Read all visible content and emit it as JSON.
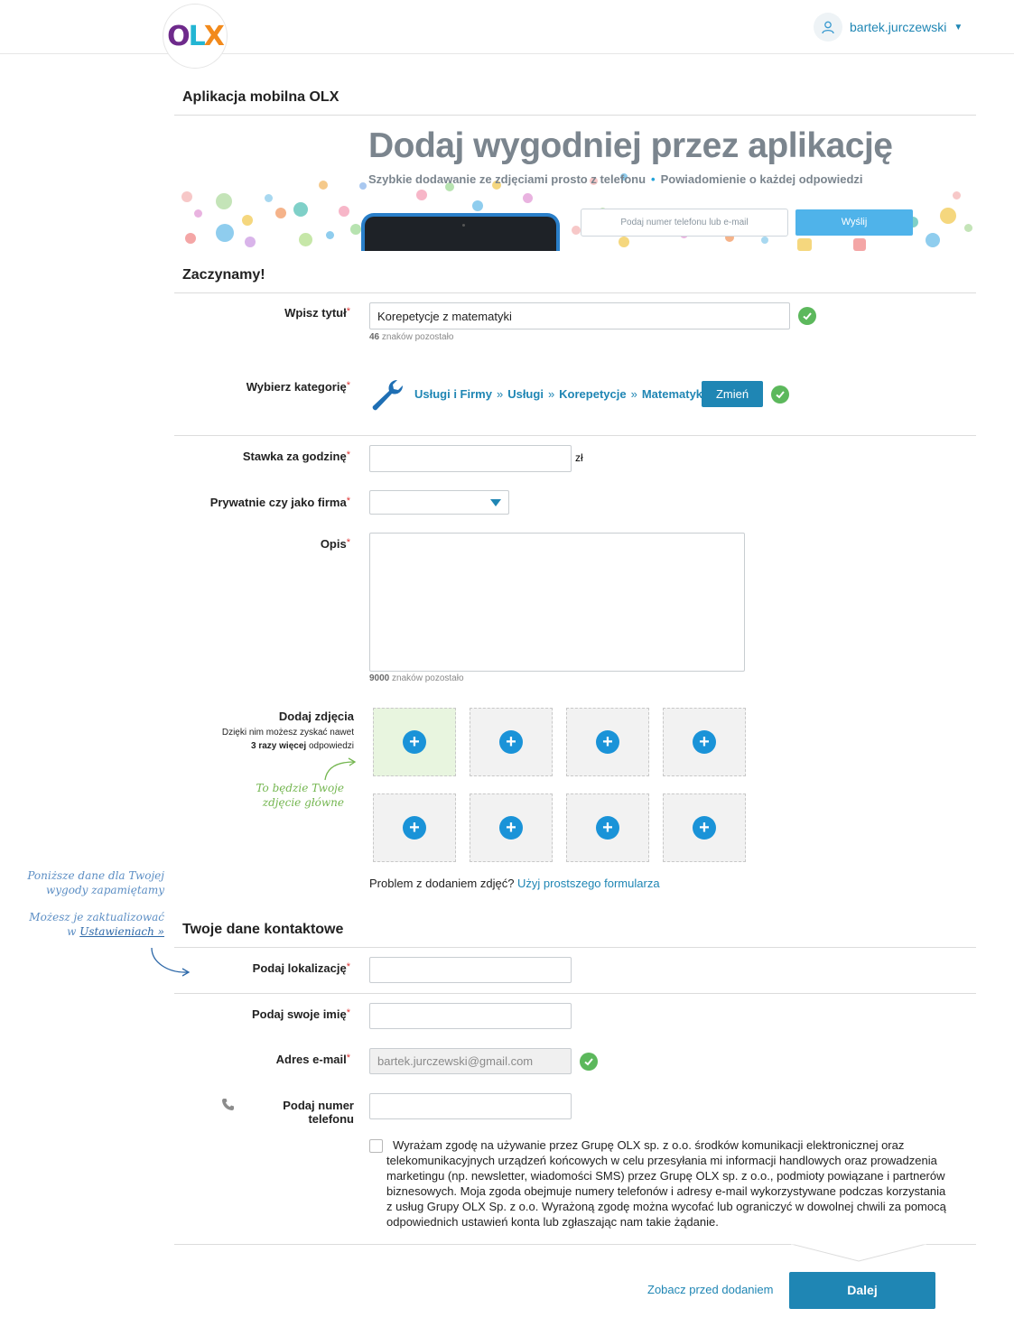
{
  "header": {
    "logo": {
      "o": "O",
      "l": "L",
      "x": "X"
    },
    "user_name": "bartek.jurczewski",
    "caret": "▼"
  },
  "mobile_app": {
    "section_title": "Aplikacja mobilna OLX",
    "banner_title": "Dodaj wygodniej przez aplikację",
    "banner_sub_left": "Szybkie dodawanie ze zdjęciami prosto z telefonu",
    "banner_sub_dot": "•",
    "banner_sub_right": "Powiadomienie o każdej odpowiedzi",
    "phone_placeholder": "Podaj numer telefonu lub e-mail",
    "send_label": "Wyślij"
  },
  "start": {
    "section_title": "Zaczynamy!",
    "title_label": "Wpisz tytuł",
    "title_value": "Korepetycje z matematyki",
    "title_remaining_count": "46",
    "title_remaining_text": "znaków pozostało",
    "category_label": "Wybierz kategorię",
    "category_path": [
      "Usługi i Firmy",
      "Usługi",
      "Korepetycje",
      "Matematyka"
    ],
    "crumb_sep": "»",
    "change_label": "Zmień",
    "rate_label": "Stawka za godzinę",
    "rate_unit": "zł",
    "type_label": "Prywatnie czy jako firma",
    "desc_label": "Opis",
    "desc_remaining_count": "9000",
    "desc_remaining_text": "znaków pozostało",
    "photos_label": "Dodaj zdjęcia",
    "photos_hint_1": "Dzięki nim możesz zyskać nawet",
    "photos_hint_bold": "3 razy więcej",
    "photos_hint_2": "odpowiedzi",
    "main_photo_note_1": "To będzie Twoje",
    "main_photo_note_2": "zdjęcie główne",
    "photo_problem_text": "Problem z dodaniem zdjęć?",
    "photo_problem_link": "Użyj prostszego formularza",
    "plus": "+"
  },
  "side_note": {
    "line1": "Poniższe dane dla Twojej",
    "line2": "wygody zapamiętamy",
    "line3": "Możesz je zaktualizować",
    "line4_pre": "w",
    "line4_link": "Ustawieniach »"
  },
  "contact": {
    "section_title": "Twoje dane kontaktowe",
    "location_label": "Podaj lokalizację",
    "name_label": "Podaj swoje imię",
    "email_label": "Adres e-mail",
    "email_value": "bartek.jurczewski@gmail.com",
    "phone_label": "Podaj numer telefonu",
    "consent_text": "Wyrażam zgodę na używanie przez Grupę OLX sp. z o.o. środków komunikacji elektronicznej oraz telekomunikacyjnych urządzeń końcowych w celu przesyłania mi informacji handlowych oraz prowadzenia marketingu (np. newsletter, wiadomości SMS) przez Grupę OLX sp. z o.o., podmioty powiązane i partnerów biznesowych. Moja zgoda obejmuje numery telefonów i adresy e-mail wykorzystywane podczas korzystania z usług Grupy OLX Sp. z o.o. Wyrażoną zgodę można wycofać lub ograniczyć w dowolnej chwili za pomocą odpowiednich ustawień konta lub zgłaszając nam takie żądanie."
  },
  "footer": {
    "preview_label": "Zobacz przed dodaniem",
    "next_label": "Dalej"
  },
  "required_mark": "*",
  "colors": {
    "accent": "#1f86b4",
    "button_light": "#4fb3ea",
    "success": "#5cb85c",
    "required": "#dd3333",
    "banner_text": "#7b858e"
  }
}
